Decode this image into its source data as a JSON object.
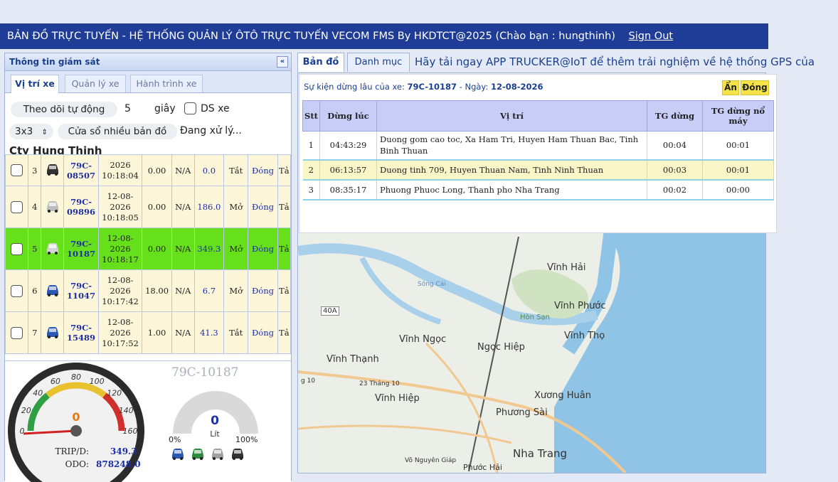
{
  "header": {
    "title": "BẢN ĐỒ TRỰC TUYẾN - HỆ THỐNG QUẢN LÝ ÔTÔ TRỰC TUYẾN VECOM FMS By HKDTCT@2025 (Chào bạn : hungthinh)",
    "signout": "Sign Out"
  },
  "left": {
    "title": "Thông tin giám sát",
    "collapse": "«",
    "tabs": [
      "Vị trí xe",
      "Quản lý xe",
      "Hành trình xe"
    ],
    "auto_follow": "Theo dõi tự động",
    "auto_value": "5",
    "seconds": "giây",
    "ds_xe": "DS xe",
    "grid_select": "3x3",
    "multi_window": "Cửa sổ nhiều bản đồ",
    "processing": "Đang xử lý...",
    "company": "Cty Hung Thinh",
    "vehicles": [
      {
        "stt": "3",
        "plate": "79C-08507",
        "datetime": "2026 10:18:04",
        "a": "0.00",
        "b": "N/A",
        "c": "0.0",
        "door": "Tắt",
        "action": "Đóng",
        "extra": "Tả",
        "color": "#333333",
        "highlight": false
      },
      {
        "stt": "4",
        "plate": "79C-09896",
        "datetime": "12-08-2026 10:18:05",
        "a": "0.00",
        "b": "N/A",
        "c": "186.0",
        "door": "Mở",
        "action": "Đóng",
        "extra": "Tả",
        "color": "#bcbcbc",
        "highlight": false
      },
      {
        "stt": "5",
        "plate": "79C-10187",
        "datetime": "12-08-2026 10:18:17",
        "a": "0.00",
        "b": "N/A",
        "c": "349.3",
        "door": "Mở",
        "action": "Đóng",
        "extra": "Tả",
        "color": "#d4d4d4",
        "highlight": true
      },
      {
        "stt": "6",
        "plate": "79C-11047",
        "datetime": "12-08-2026 10:17:42",
        "a": "18.00",
        "b": "N/A",
        "c": "6.7",
        "door": "Mở",
        "action": "Đóng",
        "extra": "Tả",
        "color": "#2c58b4",
        "highlight": false
      },
      {
        "stt": "7",
        "plate": "79C-15489",
        "datetime": "12-08-2026 10:17:52",
        "a": "1.00",
        "b": "N/A",
        "c": "41.3",
        "door": "Tắt",
        "action": "Đóng",
        "extra": "Tả",
        "color": "#2c58b4",
        "highlight": false
      }
    ],
    "gauge": {
      "plate": "79C-10187",
      "speed": "0",
      "ticks": [
        "0",
        "20",
        "40",
        "60",
        "80",
        "100",
        "120",
        "140",
        "160"
      ],
      "fuel_value": "0",
      "fuel_unit": "Lít",
      "fuel_min": "0%",
      "fuel_max": "100%",
      "trip_label": "TRIP/D:",
      "trip_value": "349.3",
      "odo_label": "ODO:",
      "odo_value": "878248.0",
      "car_colors": [
        "#2c58b4",
        "#2e8b3e",
        "#a0a0a0",
        "#333333"
      ]
    }
  },
  "right": {
    "tabs": [
      "Bản đồ",
      "Danh mục"
    ],
    "promo": "Hãy tải ngay APP TRUCKER@IoT để thêm trải nghiệm về hệ thống GPS của",
    "popup": {
      "title_prefix": "Sự kiện dừng lâu của xe:",
      "plate": "79C-10187",
      "date_prefix": "- Ngày:",
      "date": "12-08-2026",
      "hide_btn": "Ẩn",
      "close_btn": "Đóng",
      "columns": [
        "Stt",
        "Dừng lúc",
        "Vị trí",
        "TG dừng",
        "TG dừng nổ máy"
      ],
      "rows": [
        {
          "stt": "1",
          "time": "04:43:29",
          "location": "Duong gom cao toc, Xa Ham Tri, Huyen Ham Thuan Bac, Tinh Binh Thuan",
          "stop": "00:04",
          "idle": "00:01",
          "highlight": false
        },
        {
          "stt": "2",
          "time": "06:13:57",
          "location": "Duong tinh 709, Huyen Thuan Nam, Tinh Ninh Thuan",
          "stop": "00:03",
          "idle": "00:01",
          "highlight": true
        },
        {
          "stt": "3",
          "time": "08:35:17",
          "location": "Phuong Phuoc Long, Thanh pho Nha Trang",
          "stop": "00:02",
          "idle": "00:00",
          "highlight": false
        }
      ]
    },
    "map_labels": {
      "vinh_hai": "Vĩnh Hải",
      "vinh_phuoc": "Vĩnh Phước",
      "hon_san": "Hòn Sạn",
      "vinh_tho": "Vĩnh Thọ",
      "vinh_ngoc": "Vĩnh Ngọc",
      "ngoc_hiep": "Ngọc Hiệp",
      "vinh_thanh": "Vĩnh Thạnh",
      "vinh_hiep": "Vĩnh Hiệp",
      "xuong_huan": "Xương Huân",
      "phuong_sai": "Phương Sài",
      "nha_trang": "Nha Trang",
      "road_40a": "40A",
      "road_23": "23 Tháng 10",
      "road_vn": "Võ Nguyên Giáp",
      "song_cai": "Sông Cái",
      "phuoc_hai": "Phước Hải",
      "road_g10": "g 10"
    }
  }
}
